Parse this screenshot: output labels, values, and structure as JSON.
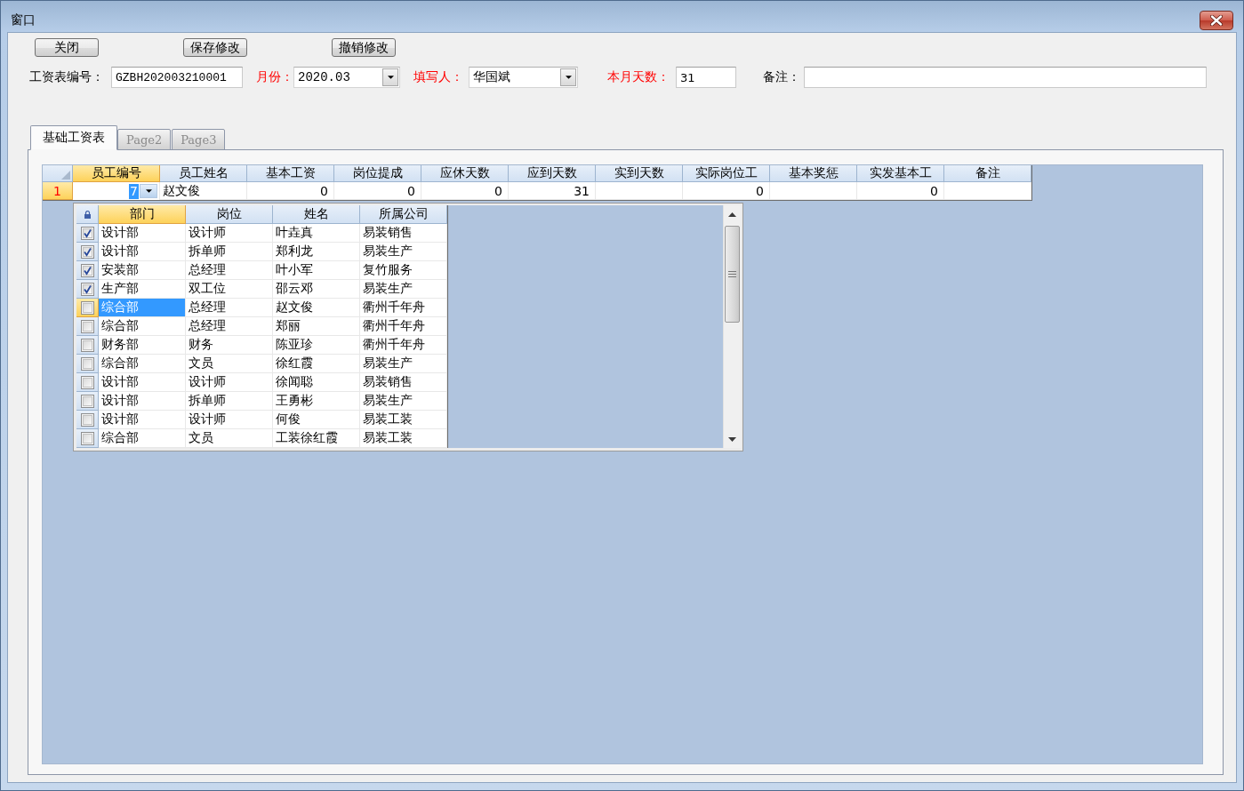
{
  "window": {
    "title": "窗口"
  },
  "toolbar": [
    {
      "label": "关闭"
    },
    {
      "label": "保存修改"
    },
    {
      "label": "撤销修改"
    }
  ],
  "form": [
    {
      "kind": "text",
      "label": "工资表编号：",
      "emphasized": false,
      "value": "GZBH202003210001"
    },
    {
      "kind": "combo",
      "label": "月份：",
      "emphasized": true,
      "value": "2020.03"
    },
    {
      "kind": "combo",
      "label": "填写人：",
      "emphasized": true,
      "value": "华国斌"
    },
    {
      "kind": "text",
      "label": "本月天数：",
      "emphasized": true,
      "value": "31"
    },
    {
      "kind": "text",
      "label": "备注：",
      "emphasized": false
    }
  ],
  "tabs": [
    {
      "label": "基础工资表",
      "selected": true
    },
    {
      "label": "Page2",
      "selected": false
    },
    {
      "label": "Page3",
      "selected": false
    }
  ],
  "grid": {
    "columns": [
      {
        "label": "员工编号",
        "kind": "lookup",
        "selected": true
      },
      {
        "label": "员工姓名",
        "kind": "text",
        "selected": false
      },
      {
        "label": "基本工资",
        "kind": "number",
        "selected": false
      },
      {
        "label": "岗位提成",
        "kind": "number",
        "selected": false
      },
      {
        "label": "应休天数",
        "kind": "number",
        "selected": false
      },
      {
        "label": "应到天数",
        "kind": "number",
        "selected": false
      },
      {
        "label": "实到天数",
        "kind": "number",
        "selected": false
      },
      {
        "label": "实际岗位工",
        "kind": "number",
        "selected": false
      },
      {
        "label": "基本奖惩",
        "kind": "number",
        "selected": false
      },
      {
        "label": "实发基本工",
        "kind": "number",
        "selected": false
      },
      {
        "label": "备注",
        "kind": "text",
        "selected": false
      }
    ],
    "rows": [
      {
        "number": "1",
        "selected": true,
        "cells": [
          "7",
          "赵文俊",
          "0",
          "0",
          "0",
          "31",
          null,
          "0",
          null,
          "0",
          null
        ]
      }
    ]
  },
  "lookup_list": {
    "open": true,
    "columns": [
      {
        "label": "部门",
        "selected": true
      },
      {
        "label": "岗位",
        "selected": false
      },
      {
        "label": "姓名",
        "selected": false
      },
      {
        "label": "所属公司",
        "selected": false
      }
    ],
    "rows": [
      {
        "checked": true,
        "selected": false,
        "cells": [
          "设计部",
          "设计师",
          "叶垚真",
          "易装销售"
        ]
      },
      {
        "checked": true,
        "selected": false,
        "cells": [
          "设计部",
          "拆单师",
          "郑利龙",
          "易装生产"
        ]
      },
      {
        "checked": true,
        "selected": false,
        "cells": [
          "安装部",
          "总经理",
          "叶小军",
          "复竹服务"
        ]
      },
      {
        "checked": true,
        "selected": false,
        "cells": [
          "生产部",
          "双工位",
          "邵云邓",
          "易装生产"
        ]
      },
      {
        "checked": false,
        "selected": true,
        "cells": [
          "综合部",
          "总经理",
          "赵文俊",
          "衢州千年舟"
        ]
      },
      {
        "checked": false,
        "selected": false,
        "cells": [
          "综合部",
          "总经理",
          "郑丽",
          "衢州千年舟"
        ]
      },
      {
        "checked": false,
        "selected": false,
        "cells": [
          "财务部",
          "财务",
          "陈亚珍",
          "衢州千年舟"
        ]
      },
      {
        "checked": false,
        "selected": false,
        "cells": [
          "综合部",
          "文员",
          "徐红霞",
          "易装生产"
        ]
      },
      {
        "checked": false,
        "selected": false,
        "cells": [
          "设计部",
          "设计师",
          "徐闻聪",
          "易装销售"
        ]
      },
      {
        "checked": false,
        "selected": false,
        "cells": [
          "设计部",
          "拆单师",
          "王勇彬",
          "易装生产"
        ]
      },
      {
        "checked": false,
        "selected": false,
        "cells": [
          "设计部",
          "设计师",
          "何俊",
          "易装工装"
        ]
      },
      {
        "checked": false,
        "selected": false,
        "cells": [
          "综合部",
          "文员",
          "工装徐红霞",
          "易装工装"
        ]
      }
    ]
  }
}
